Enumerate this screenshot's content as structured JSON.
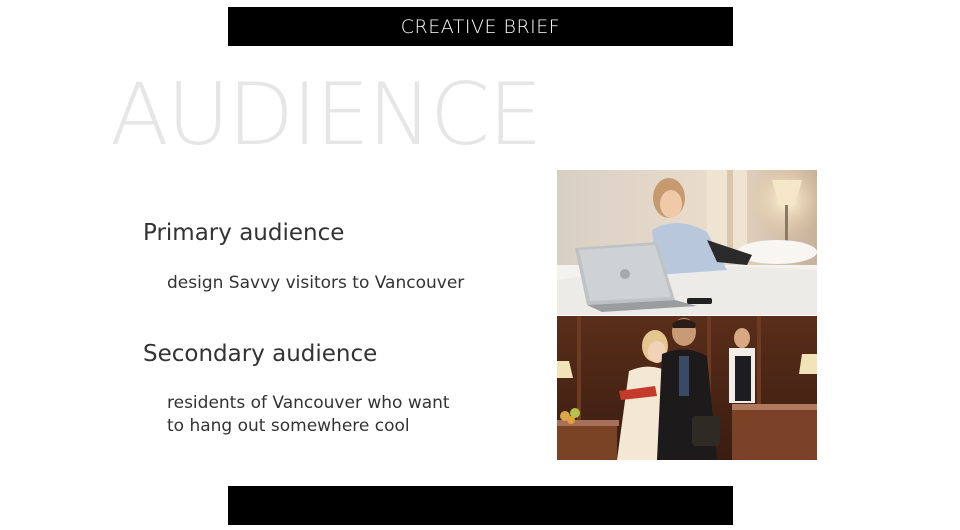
{
  "header": {
    "title": "CREATIVE BRIEF"
  },
  "slide": {
    "title": "AUDIENCE"
  },
  "primary": {
    "heading": "Primary audience",
    "text": "design Savvy visitors to Vancouver"
  },
  "secondary": {
    "heading": "Secondary audience",
    "text_line1": "residents of Vancouver who want",
    "text_line2": "to hang out somewhere cool"
  },
  "colors": {
    "bar": "#000000",
    "title": "#e6e6e6",
    "text": "#333333"
  }
}
